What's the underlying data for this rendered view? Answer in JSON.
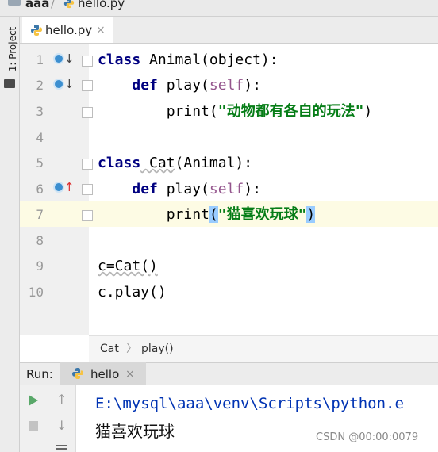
{
  "breadcrumb": {
    "project": "aaa",
    "separator": "/",
    "file": "hello.py"
  },
  "left_stripe": {
    "project_label": "1: Project"
  },
  "editor_tab": {
    "label": "hello.py",
    "close": "×"
  },
  "line_numbers": [
    "1",
    "2",
    "3",
    "4",
    "5",
    "6",
    "7",
    "8",
    "9",
    "10"
  ],
  "code": {
    "l1": {
      "kw": "class",
      "rest": " Animal(object):"
    },
    "l2": {
      "indent": "    ",
      "kw": "def",
      "name": " play(",
      "self": "self",
      "end": "):"
    },
    "l3": {
      "indent": "        ",
      "fn": "print(",
      "str": "\"动物都有各自的玩法\"",
      "end": ")"
    },
    "l5": {
      "kw": "class",
      "name": " Cat",
      "rest": "(Animal):"
    },
    "l6": {
      "indent": "    ",
      "kw": "def",
      "name": " play(",
      "self": "self",
      "end": "):"
    },
    "l7": {
      "indent": "        ",
      "fn": "print",
      "open": "(",
      "str": "\"猫喜欢玩球\"",
      "close": ")"
    },
    "l9": "c=Cat()",
    "l10": "c.play()"
  },
  "editor_breadcrumb": {
    "class": "Cat",
    "separator": "〉",
    "method": "play()"
  },
  "run_panel": {
    "label": "Run:",
    "tab_label": "hello",
    "tab_close": "×",
    "console_command": "E:\\mysql\\aaa\\venv\\Scripts\\python.e",
    "console_output": "猫喜欢玩球"
  },
  "watermark": "CSDN @00:00:0079",
  "colors": {
    "keyword": "#000080",
    "string": "#067d17",
    "self": "#94558d",
    "highlight_line": "#fdfbe4",
    "run_play": "#59a869"
  },
  "icons": [
    "python-file-icon",
    "override-down-icon",
    "override-up-icon",
    "fold-icon",
    "run-icon",
    "stop-icon",
    "up-arrow-icon",
    "down-arrow-icon"
  ]
}
